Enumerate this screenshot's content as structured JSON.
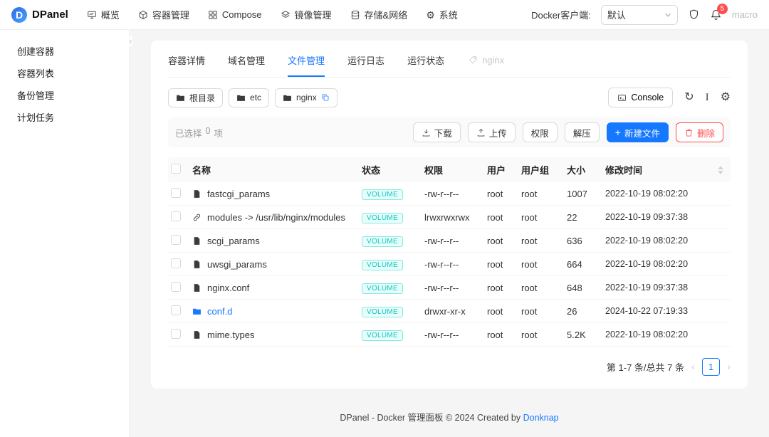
{
  "header": {
    "brand": "DPanel",
    "nav": [
      {
        "label": "概览"
      },
      {
        "label": "容器管理"
      },
      {
        "label": "Compose"
      },
      {
        "label": "镜像管理"
      },
      {
        "label": "存储&网络"
      },
      {
        "label": "系统"
      }
    ],
    "docker_client": {
      "label": "Docker客户端:",
      "value": "默认"
    },
    "notification_count": "5",
    "username": "macro"
  },
  "sidebar": {
    "items": [
      {
        "label": "创建容器"
      },
      {
        "label": "容器列表"
      },
      {
        "label": "备份管理"
      },
      {
        "label": "计划任务"
      }
    ]
  },
  "tabs": {
    "items": [
      {
        "label": "容器详情"
      },
      {
        "label": "域名管理"
      },
      {
        "label": "文件管理"
      },
      {
        "label": "运行日志"
      },
      {
        "label": "运行状态"
      }
    ],
    "active_index": 2,
    "container_name": "nginx"
  },
  "pathbar": {
    "crumbs": [
      {
        "label": "根目录"
      },
      {
        "label": "etc"
      },
      {
        "label": "nginx"
      }
    ],
    "console_label": "Console"
  },
  "icons": {
    "refresh_glyph": "↻",
    "editor_glyph": "I",
    "settings_glyph": "⚙",
    "gear_glyph": "⚙",
    "collapse_glyph": "‹",
    "prev_glyph": "‹",
    "next_glyph": "›",
    "plus_glyph": "+"
  },
  "toolbar": {
    "selected_prefix": "已选择",
    "selected_count": "0",
    "selected_suffix": "项",
    "download": "下载",
    "upload": "上传",
    "permission": "权限",
    "unzip": "解压",
    "new_file": "新建文件",
    "delete": "删除"
  },
  "table": {
    "headers": [
      "名称",
      "状态",
      "权限",
      "用户",
      "用户组",
      "大小",
      "修改时间"
    ],
    "rows": [
      {
        "icon": "file",
        "name": "fastcgi_params",
        "status": "VOLUME",
        "perm": "-rw-r--r--",
        "user": "root",
        "group": "root",
        "size": "1007",
        "mtime": "2022-10-19 08:02:20"
      },
      {
        "icon": "link",
        "name": "modules -> /usr/lib/nginx/modules",
        "status": "VOLUME",
        "perm": "lrwxrwxrwx",
        "user": "root",
        "group": "root",
        "size": "22",
        "mtime": "2022-10-19 09:37:38"
      },
      {
        "icon": "file",
        "name": "scgi_params",
        "status": "VOLUME",
        "perm": "-rw-r--r--",
        "user": "root",
        "group": "root",
        "size": "636",
        "mtime": "2022-10-19 08:02:20"
      },
      {
        "icon": "file",
        "name": "uwsgi_params",
        "status": "VOLUME",
        "perm": "-rw-r--r--",
        "user": "root",
        "group": "root",
        "size": "664",
        "mtime": "2022-10-19 08:02:20"
      },
      {
        "icon": "file",
        "name": "nginx.conf",
        "status": "VOLUME",
        "perm": "-rw-r--r--",
        "user": "root",
        "group": "root",
        "size": "648",
        "mtime": "2022-10-19 09:37:38"
      },
      {
        "icon": "folder",
        "name": "conf.d",
        "status": "VOLUME",
        "perm": "drwxr-xr-x",
        "user": "root",
        "group": "root",
        "size": "26",
        "mtime": "2024-10-22 07:19:33"
      },
      {
        "icon": "file",
        "name": "mime.types",
        "status": "VOLUME",
        "perm": "-rw-r--r--",
        "user": "root",
        "group": "root",
        "size": "5.2K",
        "mtime": "2022-10-19 08:02:20"
      }
    ]
  },
  "pagination": {
    "summary": "第 1-7 条/总共 7 条",
    "current_page": "1"
  },
  "footer": {
    "text": "DPanel - Docker 管理面板 © 2024 Created by",
    "link_label": "Donknap"
  }
}
